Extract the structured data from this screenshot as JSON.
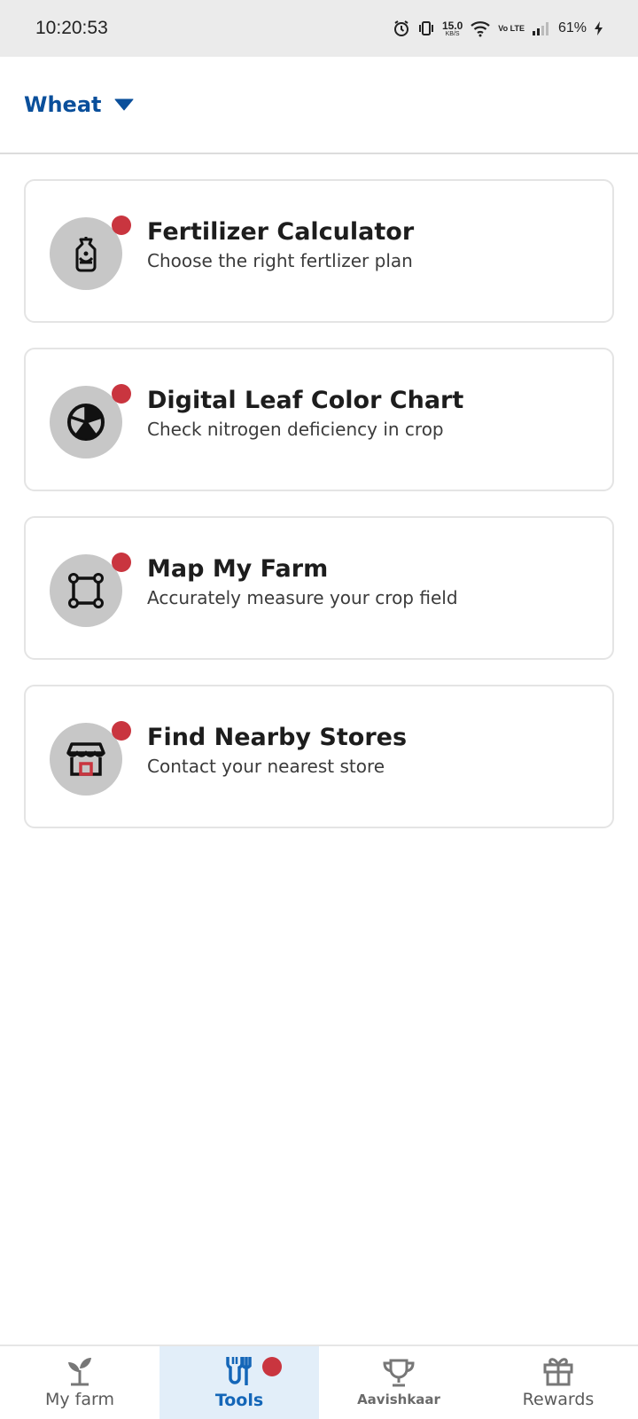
{
  "status_bar": {
    "time": "10:20:53",
    "net_speed_value": "15.0",
    "net_speed_unit": "KB/S",
    "volte": "Vo LTE",
    "battery": "61%"
  },
  "header": {
    "crop": "Wheat",
    "accent_color": "#0a4f9b"
  },
  "tools": [
    {
      "title": "Fertilizer Calculator",
      "subtitle": "Choose the right fertlizer plan",
      "icon": "fertilizer-bag-icon"
    },
    {
      "title": "Digital Leaf Color Chart",
      "subtitle": "Check nitrogen deficiency in crop",
      "icon": "color-wheel-icon"
    },
    {
      "title": "Map My Farm",
      "subtitle": "Accurately measure your crop field",
      "icon": "polygon-map-icon"
    },
    {
      "title": "Find Nearby Stores",
      "subtitle": "Contact your nearest store",
      "icon": "store-icon"
    }
  ],
  "bottom_nav": [
    {
      "label": "My farm",
      "icon": "sprout-icon",
      "active": false
    },
    {
      "label": "Tools",
      "icon": "tools-icon",
      "active": true
    },
    {
      "label": "Aavishkaar",
      "icon": "trophy-icon",
      "active": false
    },
    {
      "label": "Rewards",
      "icon": "gift-icon",
      "active": false
    }
  ],
  "colors": {
    "badge": "#c9353f",
    "active_nav_bg": "#e2eef9",
    "active_nav_text": "#1466b8"
  }
}
